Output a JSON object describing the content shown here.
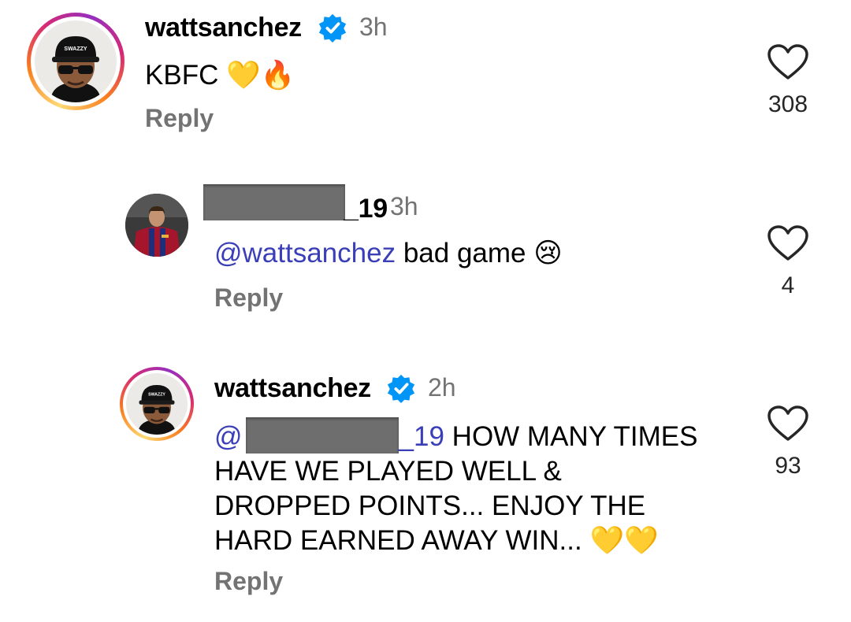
{
  "comments": [
    {
      "username": "wattsanchez",
      "time": "3h",
      "text": "KBFC",
      "emoji": "💛🔥",
      "reply_label": "Reply",
      "likes": "308"
    },
    {
      "username_suffix": "_19",
      "time": "3h",
      "mention": "@wattsanchez",
      "text": "bad game",
      "emoji": "😢",
      "reply_label": "Reply",
      "likes": "4"
    },
    {
      "username": "wattsanchez",
      "time": "2h",
      "mention_prefix": "@",
      "mention_suffix": "_19",
      "text_line1": "HOW MANY TIMES",
      "text_line2": "HAVE WE PLAYED WELL &",
      "text_line3": "DROPPED POINTS... ENJOY THE",
      "text_line4": "HARD EARNED AWAY WIN...",
      "emoji": "💛💛",
      "reply_label": "Reply",
      "likes": "93"
    }
  ],
  "avatar_cap_text": "SWAZZY",
  "colors": {
    "mention": "#3a3fb8",
    "verified": "#0095f6",
    "muted": "#737373"
  },
  "icons": [
    "verified-badge-icon",
    "heart-outline-icon"
  ]
}
